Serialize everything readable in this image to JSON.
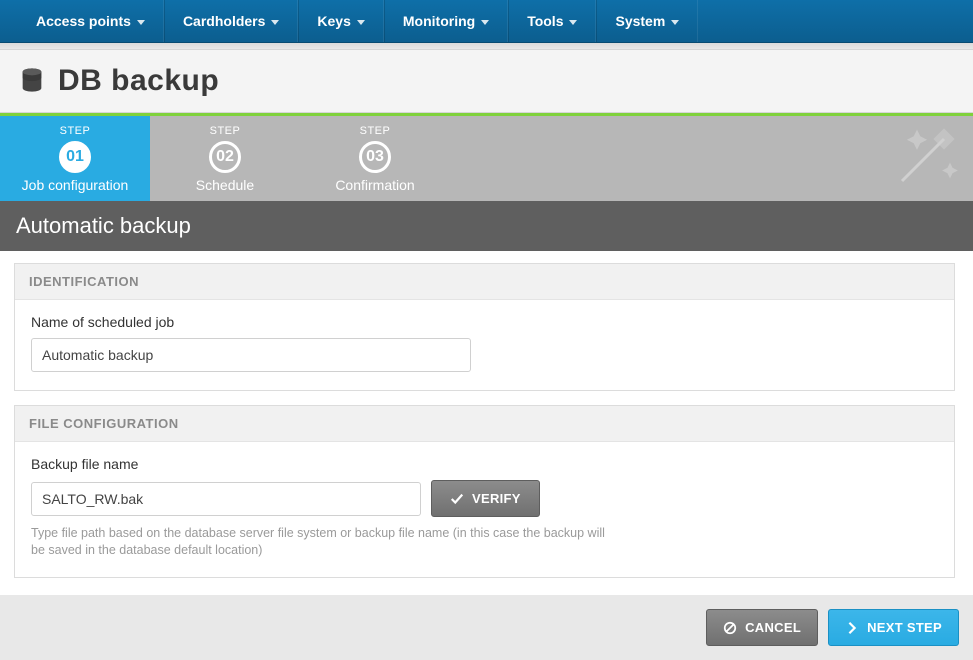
{
  "nav": {
    "items": [
      {
        "label": "Access points"
      },
      {
        "label": "Cardholders"
      },
      {
        "label": "Keys"
      },
      {
        "label": "Monitoring"
      },
      {
        "label": "Tools"
      },
      {
        "label": "System"
      }
    ]
  },
  "page": {
    "title": "DB backup"
  },
  "wizard": {
    "step_prefix": "STEP",
    "steps": [
      {
        "num": "01",
        "name": "Job configuration",
        "active": true
      },
      {
        "num": "02",
        "name": "Schedule",
        "active": false
      },
      {
        "num": "03",
        "name": "Confirmation",
        "active": false
      }
    ]
  },
  "section": {
    "title": "Automatic backup"
  },
  "panels": {
    "identification": {
      "header": "IDENTIFICATION",
      "job_name_label": "Name of scheduled job",
      "job_name_value": "Automatic backup"
    },
    "file_config": {
      "header": "FILE CONFIGURATION",
      "file_name_label": "Backup file name",
      "file_name_value": "SALTO_RW.bak",
      "verify_label": "VERIFY",
      "help_text": "Type file path based on the database server file system or backup file name (in this case the backup will be saved in the database default location)"
    }
  },
  "footer": {
    "cancel": "CANCEL",
    "next": "NEXT STEP"
  },
  "icons": {
    "database": "database-icon",
    "wand": "wand-icon",
    "check": "check-icon",
    "cancel": "cancel-icon",
    "chevron_right": "chevron-right-icon",
    "caret_down": "caret-down-icon"
  },
  "colors": {
    "nav_bg": "#0c5e8f",
    "active_step": "#29abe2",
    "wizard_bg": "#b7b7b7",
    "accent_green": "#7fd13b",
    "section_bar": "#5f5f5f"
  }
}
